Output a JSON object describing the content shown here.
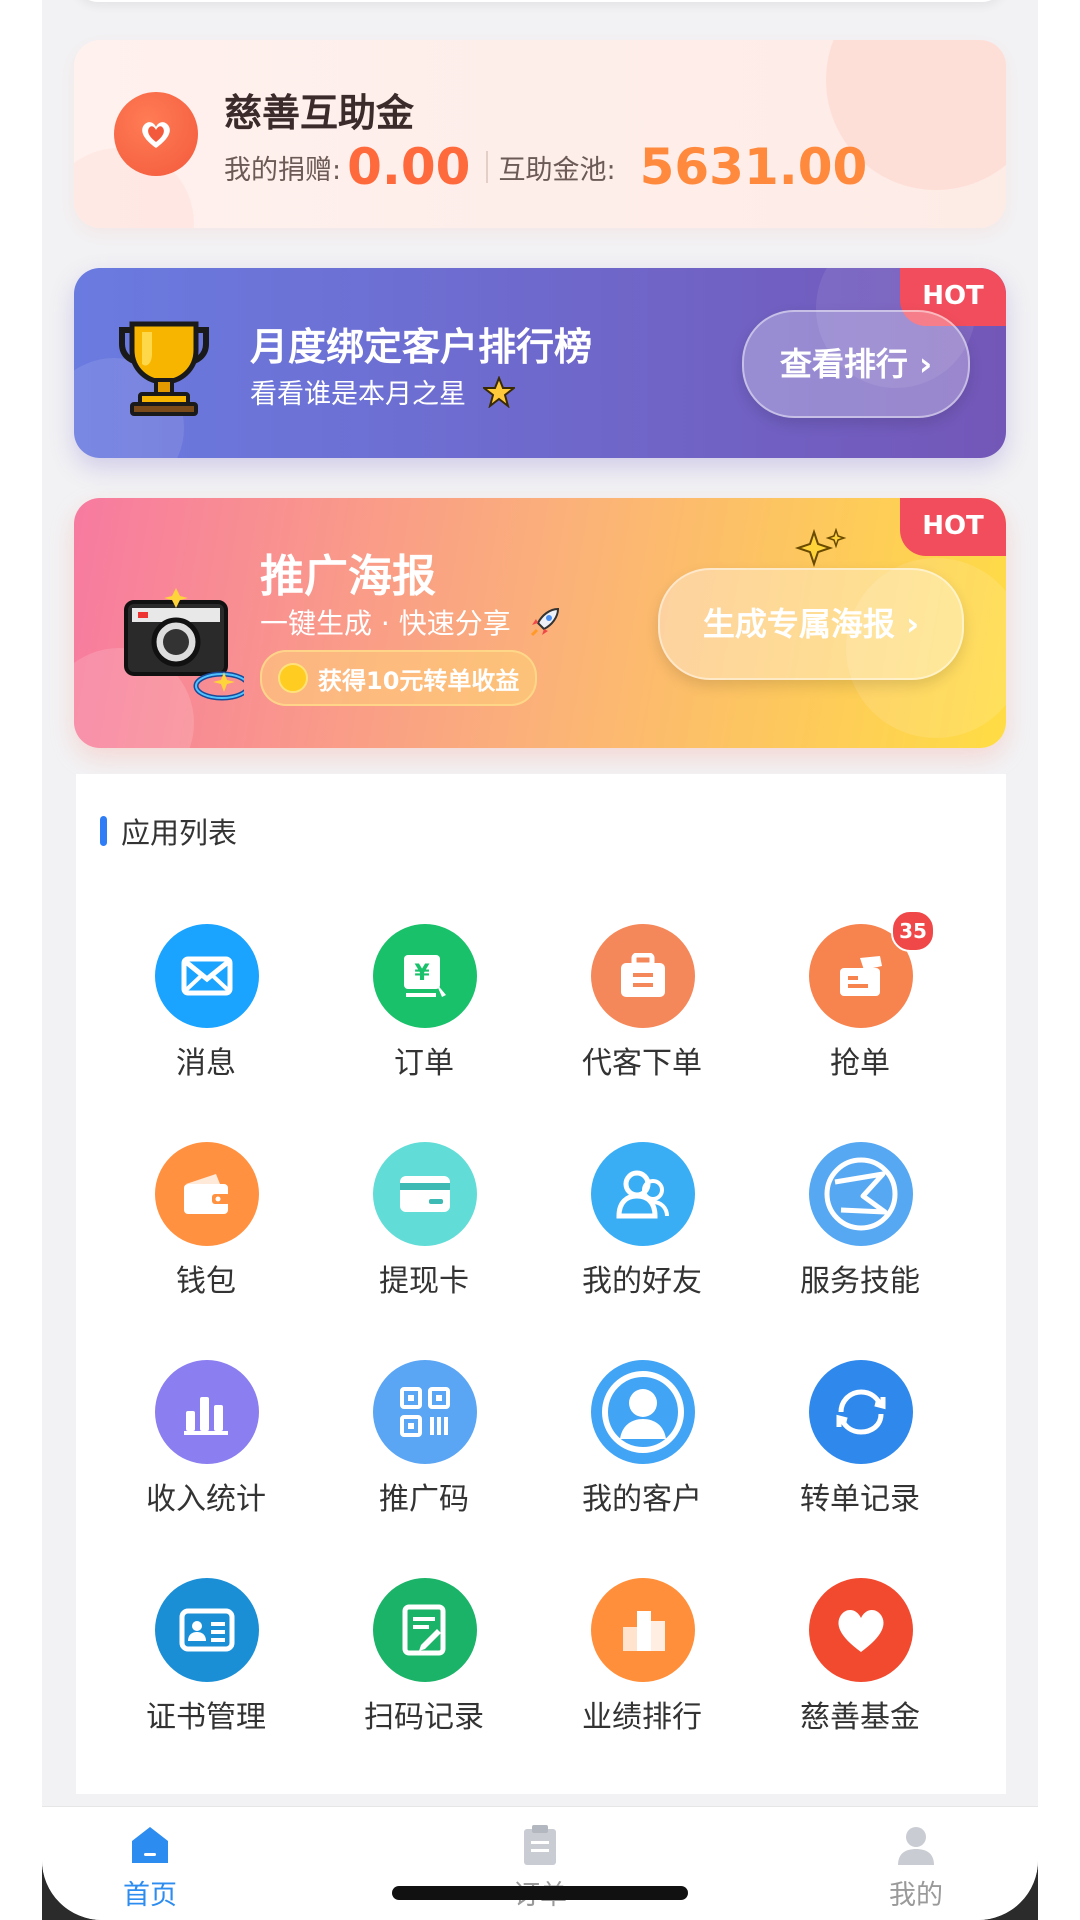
{
  "charity": {
    "title": "慈善互助金",
    "my_donation_label": "我的捐赠:",
    "my_donation_value": "0.00",
    "pool_label": "互助金池:",
    "pool_value": "5631.00",
    "icon": "heart-icon",
    "colors": {
      "donation": "#ff6a3d",
      "pool": "#ff8a3d"
    }
  },
  "ranking_banner": {
    "hot_tag": "HOT",
    "title": "月度绑定客户排行榜",
    "subtitle": "看看谁是本月之星",
    "button_label": "查看排行",
    "icon": "trophy-icon"
  },
  "poster_banner": {
    "hot_tag": "HOT",
    "title": "推广海报",
    "subtitle": "一键生成 · 快速分享",
    "reward": "获得10元转单收益",
    "button_label": "生成专属海报",
    "icon": "camera-icon"
  },
  "app_list": {
    "title": "应用列表",
    "items": [
      {
        "label": "消息",
        "icon": "mail-icon",
        "color": "#1aa3ff"
      },
      {
        "label": "订单",
        "icon": "yuan-order-icon",
        "color": "#19c16a"
      },
      {
        "label": "代客下单",
        "icon": "briefcase-icon",
        "color": "#f5885a"
      },
      {
        "label": "抢单",
        "icon": "grab-order-icon",
        "color": "#f7834f",
        "badge": "35"
      },
      {
        "label": "钱包",
        "icon": "wallet-icon",
        "color": "#ff9140"
      },
      {
        "label": "提现卡",
        "icon": "card-icon",
        "color": "#62dcd6"
      },
      {
        "label": "我的好友",
        "icon": "friends-icon",
        "color": "#3aaef5"
      },
      {
        "label": "服务技能",
        "icon": "skills-icon",
        "color": "#56a8f2"
      },
      {
        "label": "收入统计",
        "icon": "bar-chart-icon",
        "color": "#8a7ef0"
      },
      {
        "label": "推广码",
        "icon": "qr-code-icon",
        "color": "#5aa5f4"
      },
      {
        "label": "我的客户",
        "icon": "customer-icon",
        "color": "#42a4f5"
      },
      {
        "label": "转单记录",
        "icon": "refresh-icon",
        "color": "#2f88ec"
      },
      {
        "label": "证书管理",
        "icon": "id-card-icon",
        "color": "#1b8fd6"
      },
      {
        "label": "扫码记录",
        "icon": "scan-record-icon",
        "color": "#1bb368"
      },
      {
        "label": "业绩排行",
        "icon": "performance-icon",
        "color": "#ff8f3a"
      },
      {
        "label": "慈善基金",
        "icon": "heart-icon",
        "color": "#f24a2f"
      }
    ]
  },
  "tabbar": {
    "items": [
      {
        "label": "首页",
        "icon": "home-icon",
        "active": true
      },
      {
        "label": "订单",
        "icon": "order-list-icon",
        "active": false
      },
      {
        "label": "我的",
        "icon": "user-icon",
        "active": false
      }
    ],
    "active_color": "#2d8cf0",
    "inactive_color": "#9a9a9a"
  }
}
